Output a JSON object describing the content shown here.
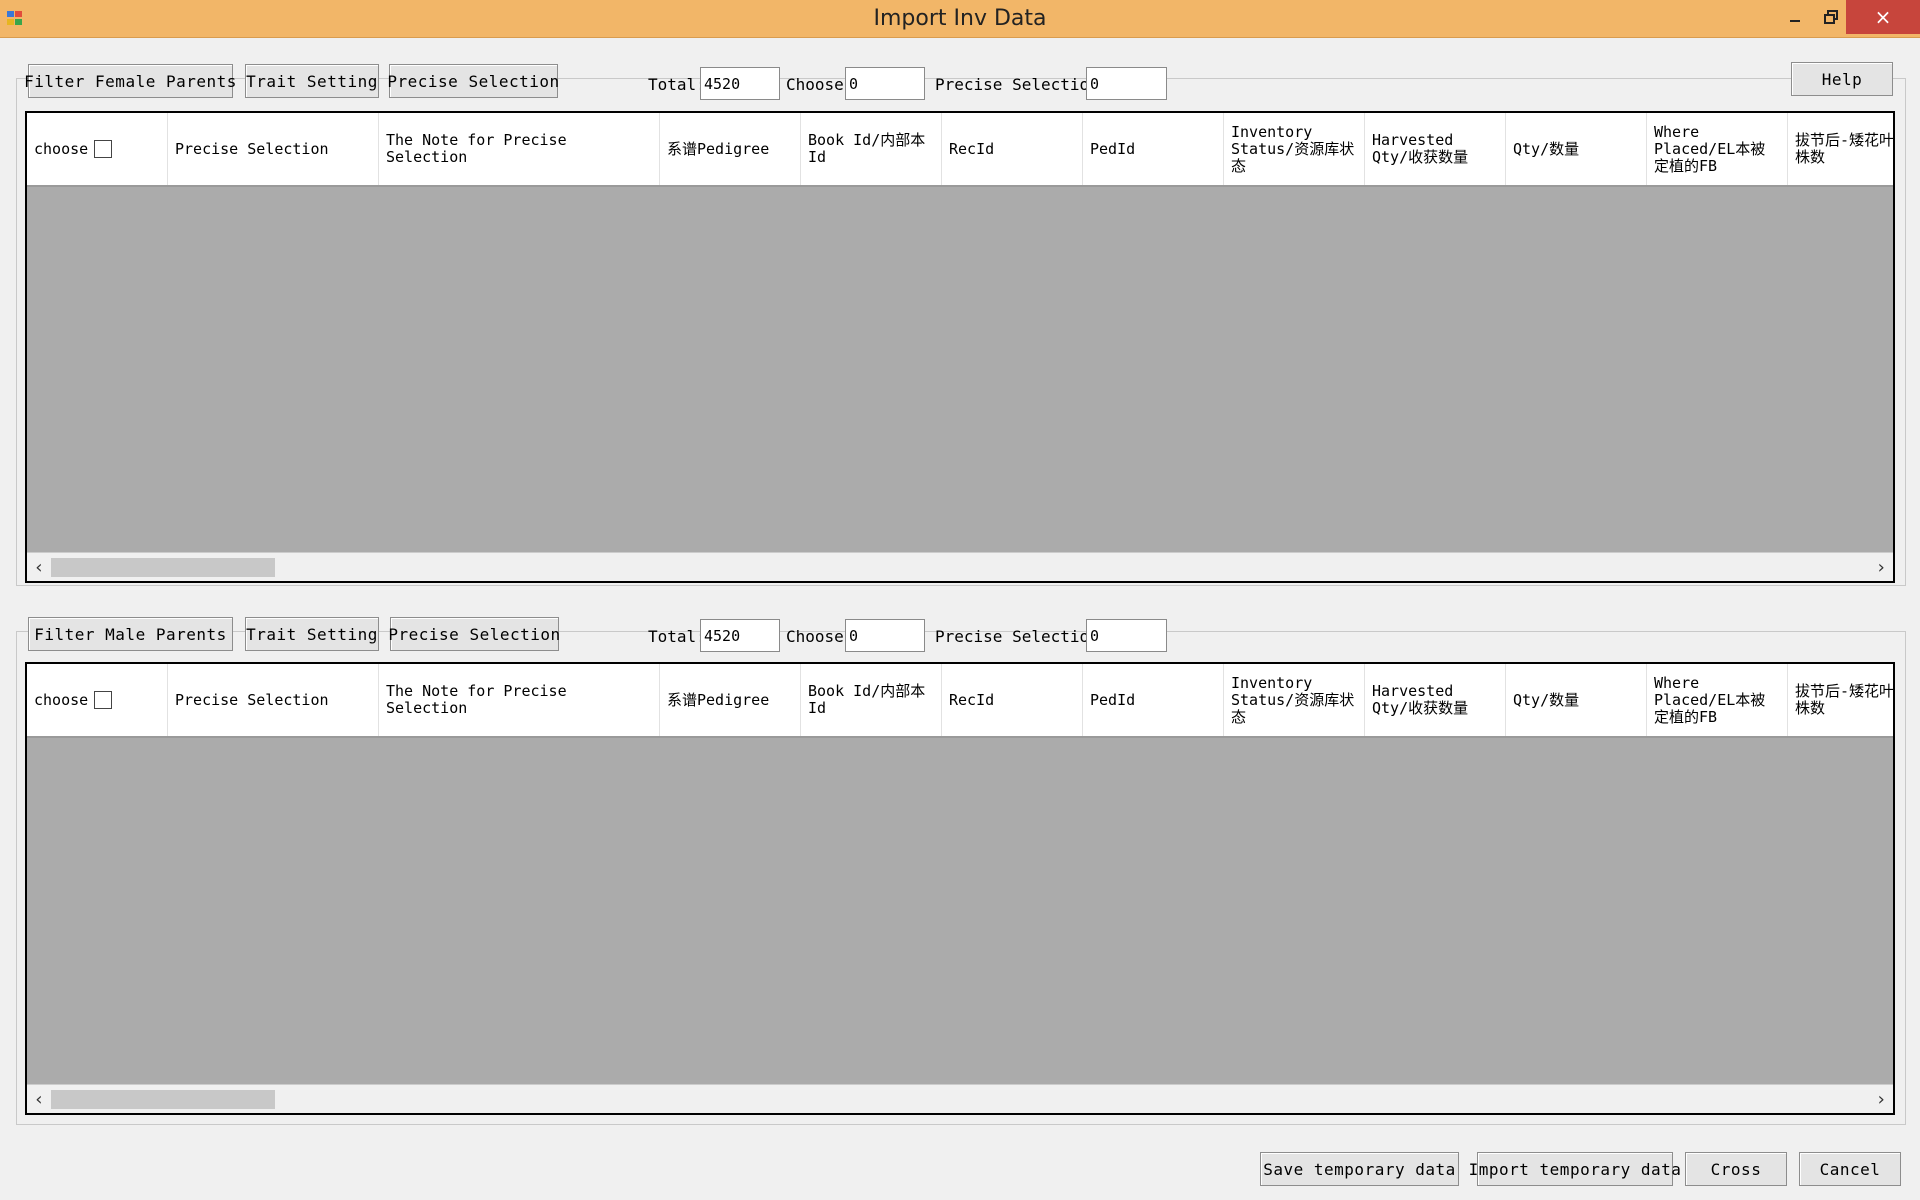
{
  "window": {
    "title": "Import Inv Data",
    "close_glyph": "×"
  },
  "top_panel": {
    "filter_button": "Filter Female Parents",
    "trait_button": "Trait Setting",
    "precise_button": "Precise Selection",
    "total_label": "Total:",
    "total_value": "4520",
    "choose_label": "Choose:",
    "choose_value": "0",
    "precise_label": "Precise Selection:",
    "precise_value": "0",
    "help_button": "Help"
  },
  "bottom_panel": {
    "filter_button": "Filter Male Parents",
    "trait_button": "Trait Setting",
    "precise_button": "Precise Selection",
    "total_label": "Total:",
    "total_value": "4520",
    "choose_label": "Choose:",
    "choose_value": "0",
    "precise_label": "Precise Selection:",
    "precise_value": "0"
  },
  "columns": [
    "choose",
    "Precise Selection",
    "The Note for Precise Selection",
    "系谱Pedigree",
    "Book Id/内部本Id",
    "RecId",
    "PedId",
    "Inventory Status/资源库状态",
    "Harvested Qty/收获数量",
    "Qty/数量",
    "Where Placed/EL本被定植的FB",
    "拔节后-矮花叶病株数"
  ],
  "scrollbar": {
    "left_arrow": "‹",
    "right_arrow": "›"
  },
  "footer": {
    "save_temp": "Save temporary data",
    "import_temp": "Import temporary data",
    "cross": "Cross",
    "cancel": "Cancel"
  }
}
